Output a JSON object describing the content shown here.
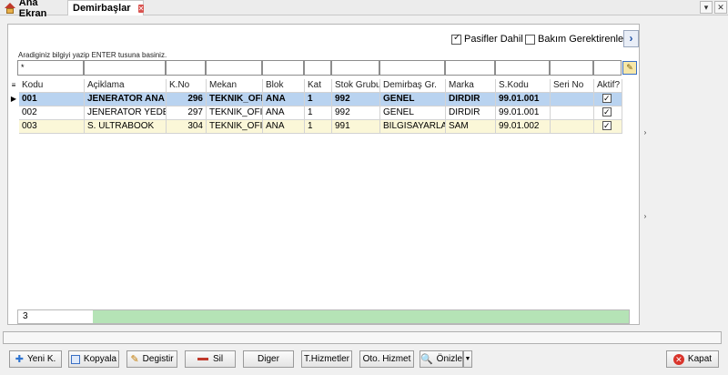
{
  "tabs": [
    {
      "label": "Ana Ekran",
      "icon": "home-icon"
    },
    {
      "label": "Demirbaşlar",
      "close_icon": "close-icon"
    }
  ],
  "window_controls": {
    "dropdown": "▾",
    "close": "✕"
  },
  "options": {
    "pasif_label": "Pasifler Dahil",
    "pasif_checked": true,
    "bakim_label": "Bakım Gerektirenler",
    "bakim_checked": false,
    "next_arrow": "›"
  },
  "search": {
    "hint": "Aradiginiz bilgiyi yazip ENTER tusuna basiniz.",
    "filters": [
      "*",
      "",
      "",
      "",
      "",
      "",
      "",
      "",
      "",
      "",
      "",
      ""
    ]
  },
  "grid": {
    "columns": [
      "Kodu",
      "Açiklama",
      "K.No",
      "Mekan",
      "Blok",
      "Kat",
      "Stok Grubu",
      "Demirbaş Gr.",
      "Marka",
      "S.Kodu",
      "Seri No",
      "Aktif?"
    ],
    "rows": [
      {
        "kodu": "001",
        "aciklama": "JENERATOR ANA",
        "kno": "296",
        "mekan": "TEKNIK_OFIS",
        "blok": "ANA",
        "kat": "1",
        "stok_grubu": "992",
        "demirbas_gr": "GENEL",
        "marka": "DIRDIR",
        "skodu": "99.01.001",
        "seri_no": "",
        "aktif": true
      },
      {
        "kodu": "002",
        "aciklama": "JENERATOR YEDEK",
        "kno": "297",
        "mekan": "TEKNIK_OFIS",
        "blok": "ANA",
        "kat": "1",
        "stok_grubu": "992",
        "demirbas_gr": "GENEL",
        "marka": "DIRDIR",
        "skodu": "99.01.001",
        "seri_no": "",
        "aktif": true
      },
      {
        "kodu": "003",
        "aciklama": "S. ULTRABOOK",
        "kno": "304",
        "mekan": "TEKNIK_OFIS",
        "blok": "ANA",
        "kat": "1",
        "stok_grubu": "991",
        "demirbas_gr": "BILGISAYARLAR",
        "marka": "SAM",
        "skodu": "99.01.002",
        "seri_no": "",
        "aktif": true
      }
    ],
    "record_count": "3"
  },
  "toolbar": {
    "yeni": "Yeni K.",
    "kopyala": "Kopyala",
    "degistir": "Degistir",
    "sil": "Sil",
    "diger": "Diger",
    "thizmetler": "T.Hizmetler",
    "oto_hizmet": "Oto. Hizmet",
    "onizle": "Önizle",
    "kapat": "Kapat"
  },
  "colors": {
    "selected_row": "#b9d3f0",
    "alt_row": "#fbf7d8",
    "footer_bar": "#b5e3b6",
    "close_icon": "#d9342b"
  }
}
